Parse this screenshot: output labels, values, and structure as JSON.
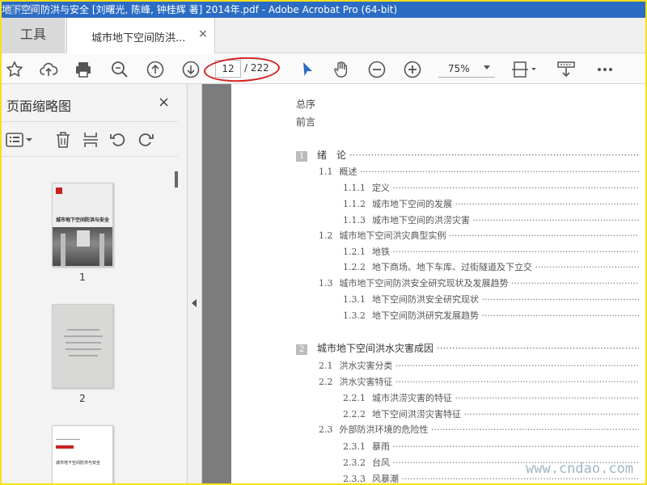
{
  "window": {
    "title": "地下空间防洪与安全 [刘曙光, 陈峰, 钟桂辉 著] 2014年.pdf - Adobe Acrobat Pro (64-bit)",
    "watermark_top": "道桥网",
    "watermark_bottom": "www.cndao.com"
  },
  "tabs": {
    "tools_label": "工具",
    "doc_label": "城市地下空间防洪...",
    "close_glyph": "×"
  },
  "toolbar": {
    "page_current": "12",
    "page_total": "/ 222",
    "zoom": "75%"
  },
  "sidepanel": {
    "title": "页面缩略图",
    "close_glyph": "×",
    "thumbnails": [
      {
        "page": "1",
        "title": "城市地下空间防洪与安全"
      },
      {
        "page": "2"
      },
      {
        "page": "",
        "title": "城市地下空间防洪与安全"
      }
    ]
  },
  "toc": {
    "front": [
      "总序",
      "前言"
    ],
    "entries": [
      {
        "level": "chapter",
        "num": "1",
        "text": "绪　论"
      },
      {
        "level": "section",
        "num": "1.1",
        "text": "概述"
      },
      {
        "level": "sub",
        "num": "1.1.1",
        "text": "定义"
      },
      {
        "level": "sub",
        "num": "1.1.2",
        "text": "城市地下空间的发展"
      },
      {
        "level": "sub",
        "num": "1.1.3",
        "text": "城市地下空间的洪涝灾害"
      },
      {
        "level": "section",
        "num": "1.2",
        "text": "城市地下空间洪灾典型实例"
      },
      {
        "level": "sub",
        "num": "1.2.1",
        "text": "地铁"
      },
      {
        "level": "sub",
        "num": "1.2.2",
        "text": "地下商场、地下车库、过街隧道及下立交"
      },
      {
        "level": "section",
        "num": "1.3",
        "text": "城市地下空间防洪安全研究现状及发展趋势"
      },
      {
        "level": "sub",
        "num": "1.3.1",
        "text": "地下空间防洪安全研究现状"
      },
      {
        "level": "sub",
        "num": "1.3.2",
        "text": "地下空间防洪研究发展趋势"
      },
      {
        "level": "chapter",
        "num": "2",
        "text": "城市地下空间洪水灾害成因"
      },
      {
        "level": "section",
        "num": "2.1",
        "text": "洪水灾害分类"
      },
      {
        "level": "section",
        "num": "2.2",
        "text": "洪水灾害特征"
      },
      {
        "level": "sub",
        "num": "2.2.1",
        "text": "城市洪涝灾害的特征"
      },
      {
        "level": "sub",
        "num": "2.2.2",
        "text": "地下空间洪涝灾害特征"
      },
      {
        "level": "section",
        "num": "2.3",
        "text": "外部防洪环境的危险性"
      },
      {
        "level": "sub",
        "num": "2.3.1",
        "text": "暴雨"
      },
      {
        "level": "sub",
        "num": "2.3.2",
        "text": "台风"
      },
      {
        "level": "sub",
        "num": "2.3.3",
        "text": "风暴潮"
      }
    ]
  },
  "colors": {
    "title_bar": "#2b6cc4",
    "accent_cursor": "#2b6cc4",
    "highlight_oval": "#d42020",
    "frame_border": "#f7e01a"
  }
}
